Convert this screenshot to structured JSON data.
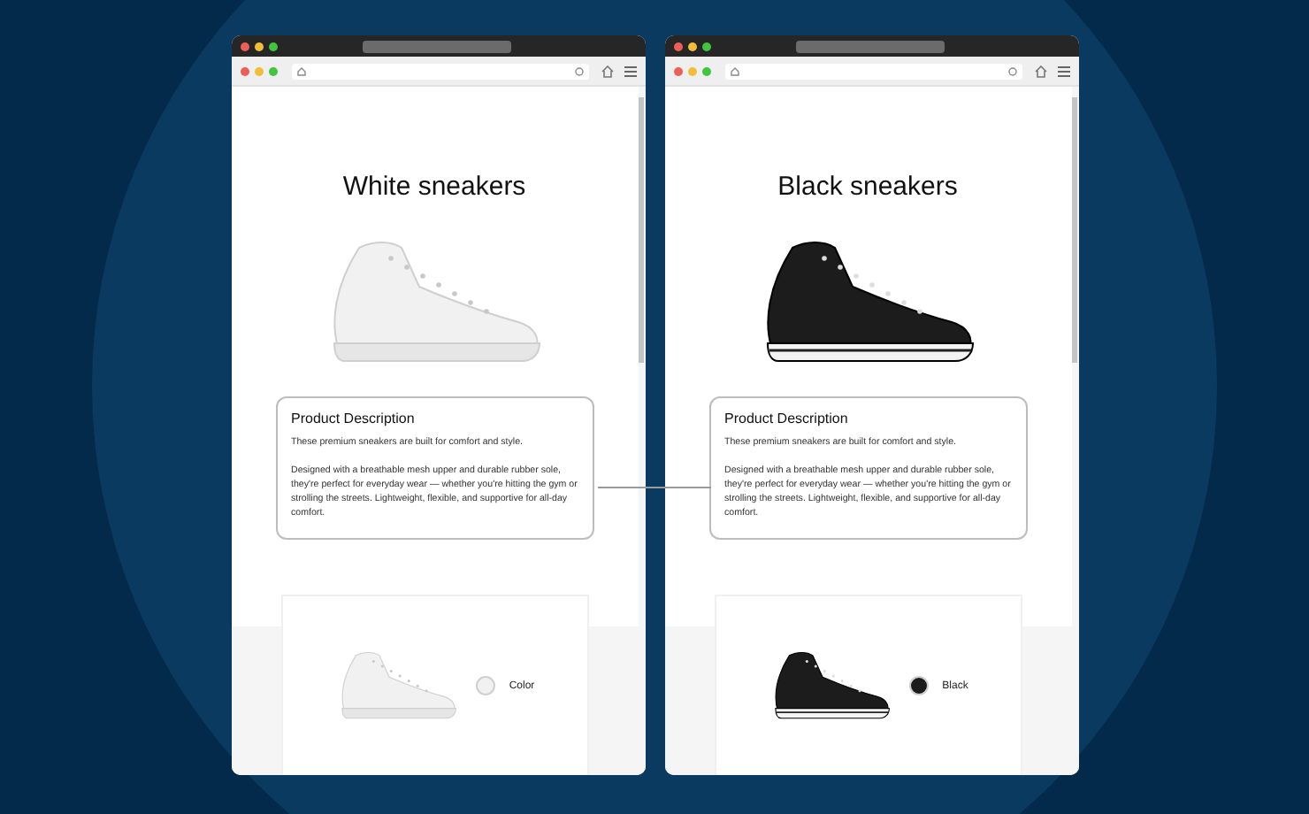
{
  "windows": [
    {
      "heading": "White sneakers",
      "description": {
        "title": "Product Description",
        "paragraphs": [
          "These premium sneakers are built for comfort and style.",
          "Designed with a breathable mesh upper and durable rubber sole, they're perfect for everyday wear — whether you're hitting the gym or strolling the streets. Lightweight, flexible, and supportive for all-day comfort."
        ]
      },
      "variant": {
        "label": "Color",
        "color": "#f1f1f1"
      }
    },
    {
      "heading": "Black sneakers",
      "description": {
        "title": "Product Description",
        "paragraphs": [
          "These premium sneakers are built for comfort and style.",
          "Designed with a breathable mesh upper and durable rubber sole, they're perfect for everyday wear — whether you're hitting the gym or strolling the streets. Lightweight, flexible, and supportive for all-day comfort."
        ]
      },
      "variant": {
        "label": "Black",
        "color": "#1c1c1c"
      }
    }
  ]
}
